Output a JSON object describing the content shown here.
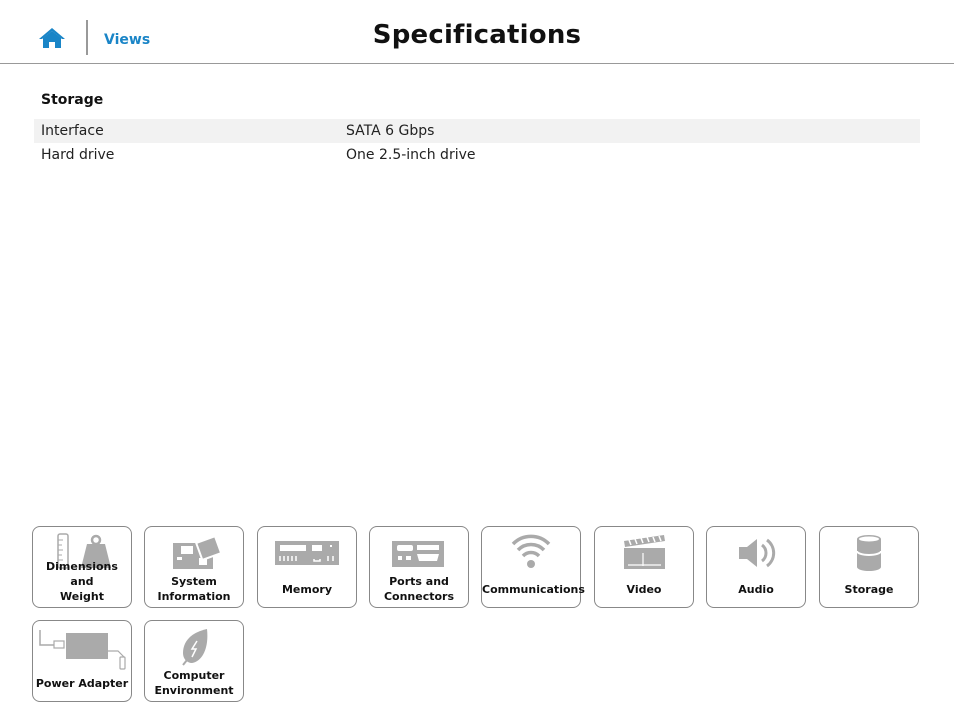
{
  "header": {
    "home_icon": "home-icon",
    "nav_link": "Views",
    "title": "Specifications",
    "accent_color": "#1a85c7"
  },
  "section": {
    "title": "Storage",
    "rows": [
      {
        "label": "Interface",
        "value": "SATA 6 Gbps"
      },
      {
        "label": "Hard drive",
        "value": "One 2.5-inch drive"
      }
    ]
  },
  "tiles": [
    {
      "label1": "Dimensions and",
      "label2": "Weight",
      "icon": "ruler-weight-icon"
    },
    {
      "label1": "System",
      "label2": "Information",
      "icon": "motherboard-icon"
    },
    {
      "label1": "Memory",
      "label2": "",
      "icon": "memory-module-icon"
    },
    {
      "label1": "Ports and",
      "label2": "Connectors",
      "icon": "ports-icon"
    },
    {
      "label1": "Communications",
      "label2": "",
      "icon": "wifi-icon"
    },
    {
      "label1": "Video",
      "label2": "",
      "icon": "clapperboard-icon"
    },
    {
      "label1": "Audio",
      "label2": "",
      "icon": "speaker-icon"
    },
    {
      "label1": "Storage",
      "label2": "",
      "icon": "storage-drum-icon"
    },
    {
      "label1": "Power Adapter",
      "label2": "",
      "icon": "power-adapter-icon"
    },
    {
      "label1": "Computer",
      "label2": "Environment",
      "icon": "leaf-icon"
    }
  ]
}
